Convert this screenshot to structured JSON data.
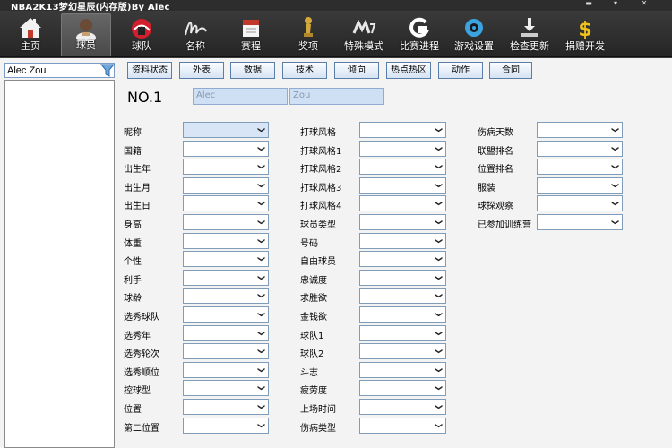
{
  "window": {
    "title": "NBA2K13梦幻星辰(内存版)By Alec"
  },
  "toolbar": {
    "items": [
      {
        "label": "主页",
        "icon": "home-icon"
      },
      {
        "label": "球员",
        "icon": "player-icon"
      },
      {
        "label": "球队",
        "icon": "team-icon"
      },
      {
        "label": "名称",
        "icon": "signature-icon"
      },
      {
        "label": "赛程",
        "icon": "calendar-icon"
      },
      {
        "label": "奖项",
        "icon": "trophy-icon"
      },
      {
        "label": "特殊模式",
        "icon": "mode-logo-icon"
      },
      {
        "label": "比赛进程",
        "icon": "gatorade-icon"
      },
      {
        "label": "游戏设置",
        "icon": "gear-icon"
      },
      {
        "label": "检查更新",
        "icon": "download-icon"
      },
      {
        "label": "捐赠开发",
        "icon": "dollar-icon"
      }
    ]
  },
  "sidebar": {
    "search_value": "Alec Zou"
  },
  "tabs": [
    "资料状态",
    "外表",
    "数据",
    "技术",
    "倾向",
    "热点热区",
    "动作",
    "合同"
  ],
  "player": {
    "number": "NO.1",
    "first_name": "Alec",
    "last_name": "Zou"
  },
  "fields": {
    "col1": [
      "昵称",
      "国籍",
      "出生年",
      "出生月",
      "出生日",
      "身高",
      "体重",
      "个性",
      "利手",
      "球龄",
      "选秀球队",
      "选秀年",
      "选秀轮次",
      "选秀顺位",
      "控球型",
      "位置",
      "第二位置"
    ],
    "col2": [
      "打球风格",
      "打球风格1",
      "打球风格2",
      "打球风格3",
      "打球风格4",
      "球员类型",
      "号码",
      "自由球员",
      "忠诚度",
      "求胜欲",
      "金钱欲",
      "球队1",
      "球队2",
      "斗志",
      "疲劳度",
      "上场时间",
      "伤病类型"
    ],
    "col3": [
      "伤病天数",
      "联盟排名",
      "位置排名",
      "服装",
      "球探观察",
      "已参加训练营"
    ]
  },
  "colors": {
    "accent": "#5b7ea9",
    "toolbar_bg": "#2d2d2d",
    "panel_bg": "#f3f3f3"
  }
}
